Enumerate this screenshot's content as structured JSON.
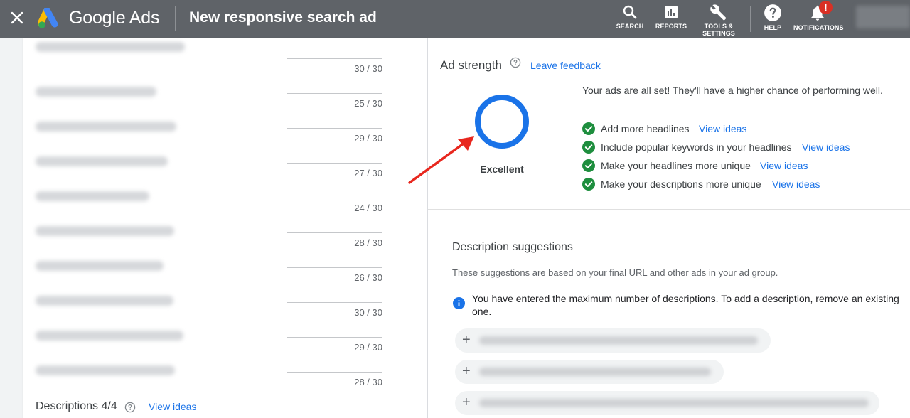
{
  "topbar": {
    "close_icon": "close-icon",
    "brand": "Google Ads",
    "page_title": "New responsive search ad",
    "tools": [
      {
        "icon": "search-icon",
        "label": "SEARCH"
      },
      {
        "icon": "reports-icon",
        "label": "REPORTS"
      },
      {
        "icon": "wrench-icon",
        "label_line1": "TOOLS &",
        "label_line2": "SETTINGS"
      },
      {
        "icon": "help-icon",
        "label": "HELP"
      },
      {
        "icon": "bell-icon",
        "label": "NOTIFICATIONS",
        "badge": "!"
      }
    ],
    "background": "#5f6368"
  },
  "headlines": {
    "counts": [
      "30 / 30",
      "25 / 30",
      "29 / 30",
      "27 / 30",
      "24 / 30",
      "28 / 30",
      "26 / 30",
      "30 / 30",
      "29 / 30",
      "28 / 30"
    ]
  },
  "descriptions": {
    "label": "Descriptions 4/4",
    "view_ideas": "View ideas"
  },
  "ad_strength": {
    "title": "Ad strength",
    "leave_feedback": "Leave feedback",
    "rating": "Excellent",
    "ring_color": "#1a73e8",
    "status_message": "Your ads are all set! They'll have a higher chance of performing well.",
    "tips": [
      {
        "text": "Add more headlines",
        "link": "View ideas"
      },
      {
        "text": "Include popular keywords in your headlines",
        "link": "View ideas"
      },
      {
        "text": "Make your headlines more unique",
        "link": "View ideas"
      },
      {
        "text": "Make your descriptions more unique",
        "link": "View ideas"
      }
    ],
    "check_color": "#1e8e3e"
  },
  "description_suggestions": {
    "title": "Description suggestions",
    "subtitle": "These suggestions are based on your final URL and other ads in your ad group.",
    "info": "You have entered the maximum number of descriptions. To add a description, remove an existing one.",
    "add_symbol": "+"
  },
  "accent_color": "#1a73e8",
  "annotation_arrow_color": "#e8271e"
}
